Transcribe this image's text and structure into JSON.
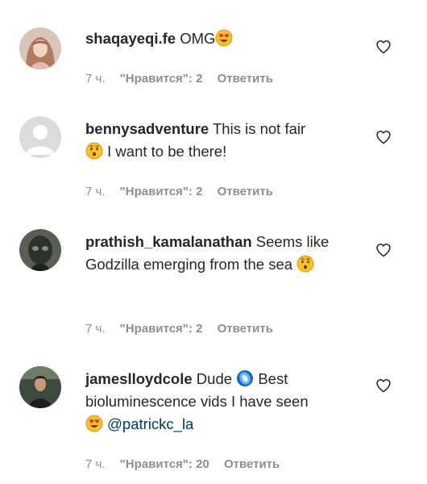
{
  "comments": [
    {
      "username": "shaqayeqi.fe",
      "text_before": "OMG",
      "emoji1": "heart-eyes-emoji",
      "time": "7 ч.",
      "likes": "\"Нравится\": 2",
      "reply": "Ответить"
    },
    {
      "username": "bennysadventure",
      "text_before": "This is not fair",
      "emoji1": "hushed-face-emoji",
      "text_after": "I want to be there!",
      "time": "7 ч.",
      "likes": "\"Нравится\": 2",
      "reply": "Ответить"
    },
    {
      "username": "prathish_kamalanathan",
      "text_before": "Seems like Godzilla emerging from the sea",
      "emoji1": "hushed-face-emoji",
      "time": "7 ч.",
      "likes": "\"Нравится\": 2",
      "reply": "Ответить"
    },
    {
      "username": "jameslloydcole",
      "text_before": "Dude",
      "emoji1": "blue-circle-emoji",
      "text_after": "Best bioluminescence vids I have seen",
      "emoji2": "heart-eyes-emoji",
      "mention": "@patrickc_la",
      "time": "7 ч.",
      "likes": "\"Нравится\": 20",
      "reply": "Ответить"
    }
  ],
  "icons": {
    "like": "heart-outline-icon"
  },
  "colors": {
    "text": "#262626",
    "meta": "#8e8e8e",
    "mention": "#00376b",
    "emoji_yellow": "#fbc02d"
  }
}
